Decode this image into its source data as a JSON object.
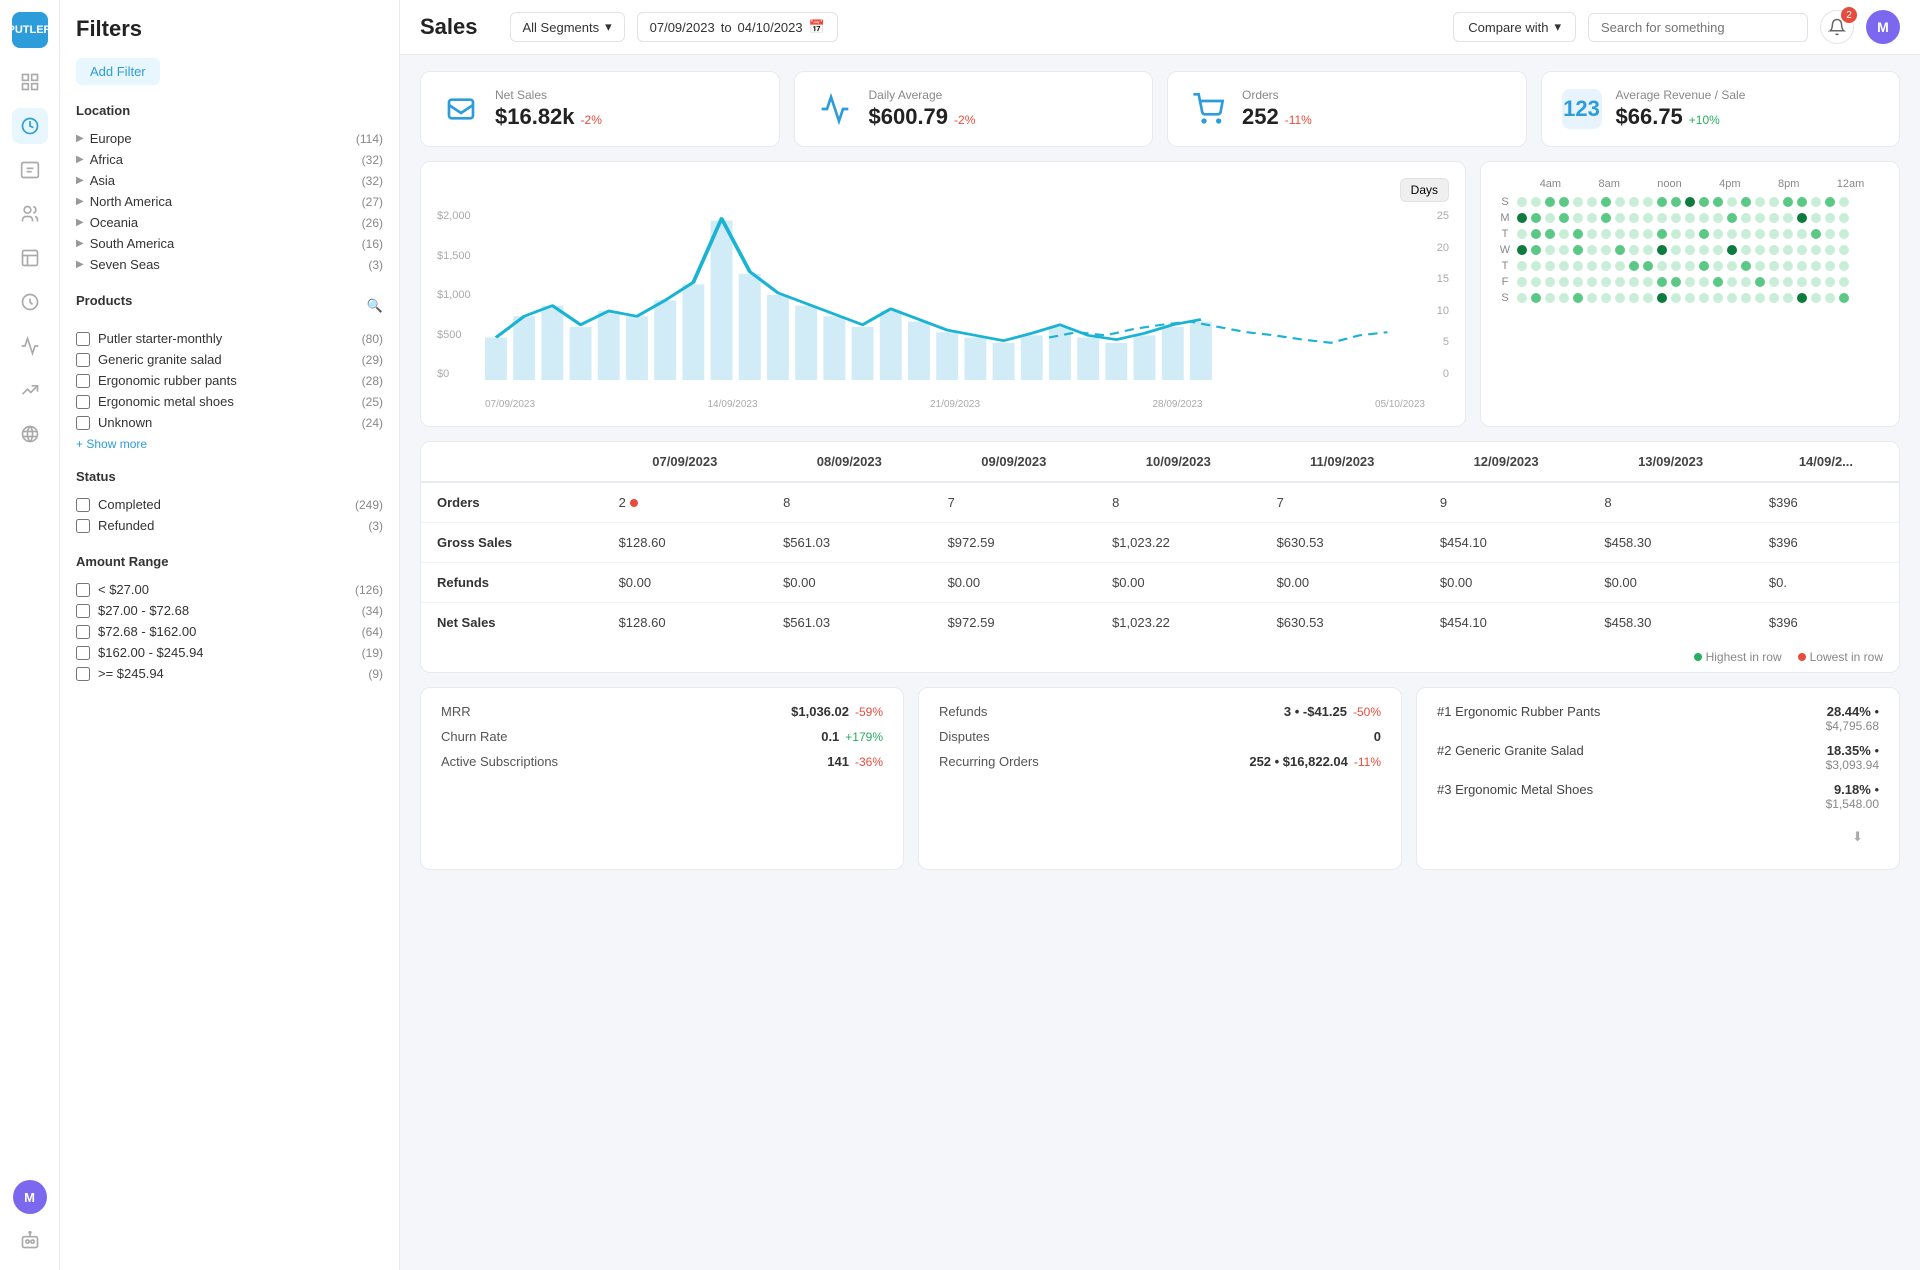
{
  "app": {
    "logo": "PUTLER",
    "title": "Sales"
  },
  "topbar": {
    "segment_label": "All Segments",
    "date_from": "07/09/2023",
    "date_to": "04/10/2023",
    "compare_label": "Compare with",
    "search_placeholder": "Search for something",
    "notification_count": "2"
  },
  "metrics": [
    {
      "label": "Net Sales",
      "value": "$16.82k",
      "change": "-2%",
      "change_type": "neg"
    },
    {
      "label": "Daily Average",
      "value": "$600.79",
      "change": "-2%",
      "change_type": "neg"
    },
    {
      "label": "Orders",
      "value": "252",
      "change": "-11%",
      "change_type": "neg"
    },
    {
      "label": "Average Revenue / Sale",
      "value": "$66.75",
      "change": "+10%",
      "change_type": "pos"
    }
  ],
  "chart": {
    "days_btn": "Days",
    "y_labels": [
      "$2,000",
      "$1,500",
      "$1,000",
      "$500",
      "$0"
    ],
    "y2_labels": [
      "25",
      "20",
      "15",
      "10",
      "5",
      "0"
    ],
    "x_dates": [
      "07/09/2023",
      "14/09/2023",
      "21/09/2023",
      "28/09/2023",
      "05/10/2023"
    ]
  },
  "heatmap": {
    "times": [
      "4am",
      "8am",
      "noon",
      "4pm",
      "8pm",
      "12am"
    ],
    "days": [
      "S",
      "M",
      "T",
      "W",
      "T",
      "F",
      "S"
    ]
  },
  "filters": {
    "title": "Filters",
    "add_filter": "Add Filter",
    "location": {
      "label": "Location",
      "items": [
        {
          "name": "Europe",
          "count": 114
        },
        {
          "name": "Africa",
          "count": 32
        },
        {
          "name": "Asia",
          "count": 32
        },
        {
          "name": "North America",
          "count": 27
        },
        {
          "name": "Oceania",
          "count": 26
        },
        {
          "name": "South America",
          "count": 16
        },
        {
          "name": "Seven Seas",
          "count": 3
        }
      ]
    },
    "products": {
      "label": "Products",
      "items": [
        {
          "name": "Putler starter-monthly",
          "count": 80
        },
        {
          "name": "Generic granite salad",
          "count": 29
        },
        {
          "name": "Ergonomic rubber pants",
          "count": 28
        },
        {
          "name": "Ergonomic metal shoes",
          "count": 25
        },
        {
          "name": "Unknown",
          "count": 24
        }
      ],
      "show_more": "+ Show more"
    },
    "status": {
      "label": "Status",
      "items": [
        {
          "name": "Completed",
          "count": 249
        },
        {
          "name": "Refunded",
          "count": 3
        }
      ]
    },
    "amount_range": {
      "label": "Amount Range",
      "items": [
        {
          "name": "< $27.00",
          "count": 126
        },
        {
          "name": "$27.00 - $72.68",
          "count": 34
        },
        {
          "name": "$72.68 - $162.00",
          "count": 64
        },
        {
          "name": "$162.00 - $245.94",
          "count": 19
        },
        {
          "name": ">= $245.94",
          "count": 9
        }
      ]
    }
  },
  "table": {
    "columns": [
      "",
      "07/09/2023",
      "08/09/2023",
      "09/09/2023",
      "10/09/2023",
      "11/09/2023",
      "12/09/2023",
      "13/09/2023",
      "14/09/2..."
    ],
    "rows": [
      {
        "label": "Orders",
        "values": [
          "2",
          "8",
          "7",
          "8",
          "7",
          "9",
          "8",
          "$396"
        ],
        "has_badge": true
      },
      {
        "label": "Gross Sales",
        "values": [
          "$128.60",
          "$561.03",
          "$972.59",
          "$1,023.22",
          "$630.53",
          "$454.10",
          "$458.30",
          "$396"
        ]
      },
      {
        "label": "Refunds",
        "values": [
          "$0.00",
          "$0.00",
          "$0.00",
          "$0.00",
          "$0.00",
          "$0.00",
          "$0.00",
          "$0."
        ]
      },
      {
        "label": "Net Sales",
        "values": [
          "$128.60",
          "$561.03",
          "$972.59",
          "$1,023.22",
          "$630.53",
          "$454.10",
          "$458.30",
          "$396"
        ]
      }
    ],
    "legend": {
      "highest": "Highest in row",
      "lowest": "Lowest in row"
    }
  },
  "subscriptions": {
    "items": [
      {
        "label": "MRR",
        "value": "$1,036.02",
        "change": "-59%",
        "change_type": "neg"
      },
      {
        "label": "Churn Rate",
        "value": "0.1",
        "change": "+179%",
        "change_type": "pos"
      },
      {
        "label": "Active Subscriptions",
        "value": "141",
        "change": "-36%",
        "change_type": "neg"
      }
    ]
  },
  "refunds_disputes": {
    "items": [
      {
        "label": "Refunds",
        "value": "3",
        "extra": "• -$41.25",
        "change": "-50%",
        "change_type": "neg"
      },
      {
        "label": "Disputes",
        "value": "0",
        "extra": "",
        "change": "",
        "change_type": ""
      },
      {
        "label": "Recurring Orders",
        "value": "252",
        "extra": "• $16,822.04",
        "change": "-11%",
        "change_type": "neg"
      }
    ]
  },
  "top_products": {
    "items": [
      {
        "rank": "#1",
        "name": "Ergonomic Rubber Pants",
        "pct": "28.44%",
        "value": "$4,795.68"
      },
      {
        "rank": "#2",
        "name": "Generic Granite Salad",
        "pct": "18.35%",
        "value": "$3,093.94"
      },
      {
        "rank": "#3",
        "name": "Ergonomic Metal Shoes",
        "pct": "9.18%",
        "value": "$1,548.00"
      }
    ]
  }
}
